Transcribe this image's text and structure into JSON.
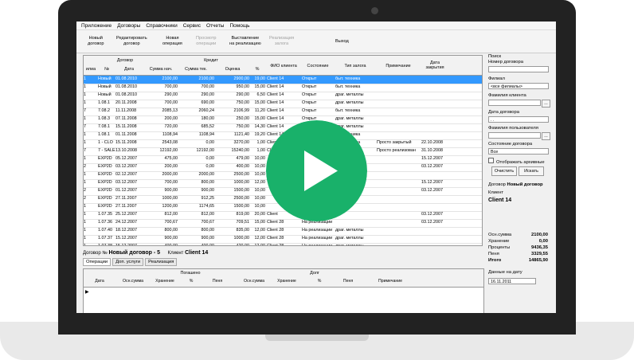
{
  "menu": [
    "Приложение",
    "Договоры",
    "Справочники",
    "Сервис",
    "Отчеты",
    "Помощь"
  ],
  "toolbar": [
    {
      "label": "Новый\nдоговор",
      "enabled": true
    },
    {
      "label": "Редактировать\nдоговор",
      "enabled": true
    },
    {
      "label": "Новая\nоперация",
      "enabled": true
    },
    {
      "label": "Просмотр\nоперации",
      "enabled": false
    },
    {
      "label": "Выставление\nна реализацию",
      "enabled": true
    },
    {
      "label": "Реализация\nзалога",
      "enabled": false
    },
    {
      "label": "Выход",
      "enabled": true
    }
  ],
  "grid": {
    "group_headers": {
      "dogovor": "Договор",
      "kredit": "Кредит"
    },
    "columns": [
      "илиа",
      "№",
      "Дата",
      "Сумма нач.",
      "Сумма тек.",
      "Оценка",
      "%",
      "ФИО клиента",
      "Состояние",
      "Тип залога",
      "Примечание",
      "Дата закрытия"
    ],
    "rows": [
      [
        "1",
        "Новый",
        "01.08.2010",
        "2100,00",
        "2100,00",
        "2900,00",
        "19,00",
        "Client 14",
        "Открыт",
        "быт. техника",
        "",
        ""
      ],
      [
        "1",
        "Новый",
        "01.08.2010",
        "700,00",
        "700,00",
        "950,00",
        "15,00",
        "Client 14",
        "Открыт",
        "быт. техника",
        "",
        ""
      ],
      [
        "1",
        "Новый",
        "01.08.2010",
        "290,00",
        "290,00",
        "290,00",
        "6,50",
        "Client 14",
        "Открыт",
        "драг. металлы",
        "",
        ""
      ],
      [
        "1",
        "1.08.1",
        "20.11.2008",
        "700,00",
        "690,00",
        "750,00",
        "15,00",
        "Client 14",
        "Открыт",
        "драг. металлы",
        "",
        ""
      ],
      [
        "7",
        "7.08.2",
        "11.11.2008",
        "2085,13",
        "2060,24",
        "2106,99",
        "11,20",
        "Client 14",
        "Открыт",
        "быт. техника",
        "",
        ""
      ],
      [
        "1",
        "1.08.3",
        "07.11.2008",
        "200,00",
        "180,00",
        "250,00",
        "15,00",
        "Client 14",
        "Открыт",
        "драг. металлы",
        "",
        ""
      ],
      [
        "7",
        "7.08.1",
        "15.11.2008",
        "720,00",
        "685,52",
        "750,00",
        "14,30",
        "Client 14",
        "Открыт",
        "драг. металлы",
        "",
        ""
      ],
      [
        "1",
        "1.08.1",
        "01.11.2008",
        "1108,94",
        "1108,94",
        "1121,40",
        "19,20",
        "Client 14",
        "Открыт",
        "быт. техника",
        "",
        ""
      ],
      [
        "1",
        "1 - CLO",
        "15.11.2008",
        "2543,08",
        "0,00",
        "3270,00",
        "1,00",
        "Client 14",
        "Закрыт",
        "быт. техника",
        "Просто закрытый",
        "22.10.2008"
      ],
      [
        "7",
        "7 - SALE",
        "13.10.2008",
        "12192,00",
        "12192,00",
        "15240,00",
        "1,00",
        "Client 14",
        "Реализован",
        "",
        "Просто реализован",
        "31.10.2008"
      ],
      [
        "1",
        "EXP2D",
        "05.12.2007",
        "475,00",
        "0,00",
        "479,00",
        "10,00",
        "",
        "",
        "",
        "",
        "15.12.2007"
      ],
      [
        "2",
        "EXP2D",
        "03.12.2007",
        "200,00",
        "0,00",
        "400,00",
        "10,00",
        "",
        "",
        "",
        "",
        "03.12.2007"
      ],
      [
        "1",
        "EXP2D",
        "02.12.2007",
        "2000,00",
        "2000,00",
        "2500,00",
        "10,00",
        "",
        "",
        "",
        "",
        ""
      ],
      [
        "1",
        "EXP2D",
        "03.12.2007",
        "700,00",
        "800,00",
        "1000,00",
        "12,00",
        "",
        "",
        "",
        "",
        "15.12.2007"
      ],
      [
        "2",
        "EXP2D",
        "01.12.2007",
        "900,00",
        "900,00",
        "1500,00",
        "10,00",
        "",
        "",
        "",
        "",
        "03.12.2007"
      ],
      [
        "2",
        "EXP2D",
        "27.11.2007",
        "1000,00",
        "912,25",
        "2500,00",
        "10,00",
        "",
        "",
        "",
        "",
        ""
      ],
      [
        "1",
        "EXP2D",
        "27.11.2007",
        "1200,00",
        "1174,65",
        "1500,00",
        "10,00",
        "",
        "",
        "",
        "",
        ""
      ],
      [
        "1",
        "1.07.35",
        "25.12.2007",
        "812,00",
        "812,00",
        "819,00",
        "20,00",
        "Client",
        "",
        "",
        "",
        "03.12.2007"
      ],
      [
        "1",
        "1.07.36",
        "24.12.2007",
        "700,67",
        "700,67",
        "709,51",
        "15,00",
        "Client 28",
        "На реализации",
        "",
        "",
        "03.12.2007"
      ],
      [
        "1",
        "1.07.40",
        "18.12.2007",
        "800,00",
        "800,00",
        "835,00",
        "12,00",
        "Client 28",
        "На реализации",
        "драг. металлы",
        "",
        ""
      ],
      [
        "1",
        "1.07.37",
        "15.12.2007",
        "900,00",
        "900,00",
        "1000,00",
        "12,00",
        "Client 28",
        "На реализации",
        "драг. металлы",
        "",
        ""
      ],
      [
        "1",
        "1.07.38",
        "15.12.2007",
        "400,00",
        "400,00",
        "420,00",
        "12,00",
        "Client 28",
        "На реализации",
        "драг. металлы",
        "",
        ""
      ],
      [
        "7",
        "7.07.51",
        "12.12.2007",
        "336,40",
        "336,40",
        "339,30",
        "15,00",
        "Client 28",
        "Реализован",
        "драг. металлы",
        "",
        "03.12.2007"
      ]
    ]
  },
  "side": {
    "search_label": "Поиск",
    "contract_label": "Номер договора",
    "branch_label": "Филиал",
    "branch_value": "<все филиалы>",
    "client_label": "Фамилия клиента",
    "date_label": "Дата договора",
    "date_value": ". .",
    "user_label": "Фамилия пользователя",
    "state_label": "Состояние договора",
    "state_value": "Все",
    "archive_label": "Отображать архивные",
    "clear_btn": "Очистить",
    "search_btn": "Искать",
    "contract_head": "Договор",
    "contract_name": "Новый договор",
    "client_head": "Клиент",
    "client_name": "Client 14",
    "sums": [
      {
        "k": "Осн.сумма",
        "v": "2100,00"
      },
      {
        "k": "Хранение",
        "v": "0,00"
      },
      {
        "k": "Проценты",
        "v": "9436,35"
      },
      {
        "k": "Пеня",
        "v": "3329,55"
      }
    ],
    "total_k": "Итого",
    "total_v": "14865,90",
    "ondate_label": "Данные на дату",
    "ondate_value": "16.11.2011"
  },
  "bottom": {
    "title_pref": "Договор №",
    "title_val": "Новый договор - 5",
    "client_pref": "Клиент",
    "client_val": "Client 14",
    "tabs": [
      "Операции",
      "Доп. услуги",
      "Реализация"
    ],
    "h_pogasheno": "Погашено",
    "h_dolg": "Долг",
    "cols": [
      "Дата",
      "Осн.сумма",
      "Хранение",
      "%",
      "Пеня",
      "Осн.сумма",
      "Хранение",
      "%",
      "Пеня",
      "Примечание"
    ]
  }
}
